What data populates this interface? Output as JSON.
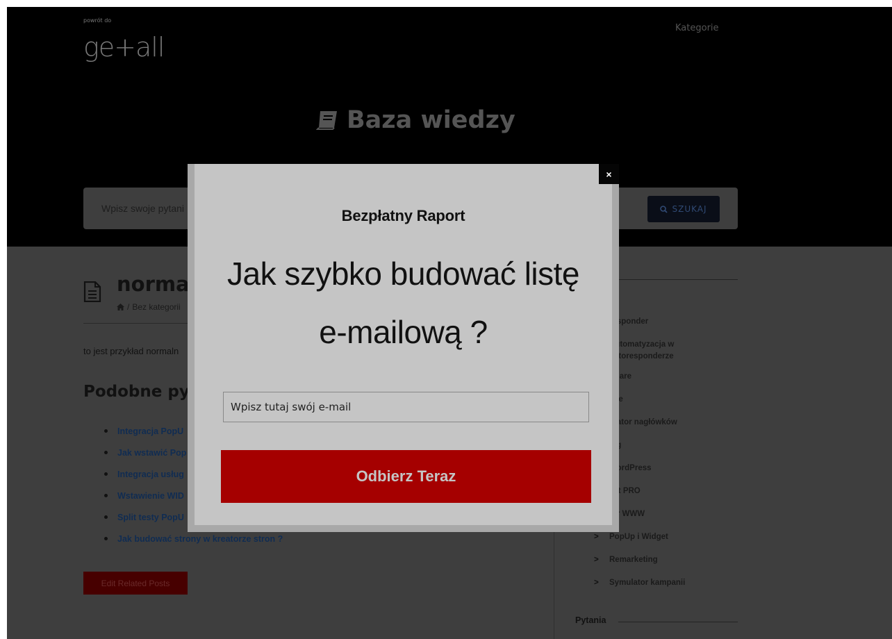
{
  "header": {
    "back_link": "powrót do",
    "logo": "ge+all",
    "nav_categories": "Kategorie",
    "hero_title": "Baza wiedzy",
    "search_placeholder": "Wpisz swoje pytani",
    "search_button": "SZUKAJ"
  },
  "post": {
    "title": "normaln",
    "breadcrumb_sep": "/",
    "breadcrumb_category": "Bez kategorii",
    "body": "to jest przykład normaln",
    "related_title": "Podobne pytan",
    "related_items": [
      "Integracja PopU",
      "Jak wstawić Pop",
      "Integracja usług",
      "Wstawienie WID",
      "Split testy PopU",
      "Jak budować strony w kreatorze stron ?"
    ],
    "edit_button": "Edit Related Posts"
  },
  "sidebar": {
    "items": [
      "responder",
      "Automatyzacja w autoresponderze",
      "Share",
      "nse",
      "erator nagłówków",
      "ing",
      "WordPress",
      "est PRO",
      "tor WWW",
      "PopUp i Widget",
      "Remarketing",
      "Symulator kampanii"
    ],
    "pytania": "Pytania"
  },
  "modal": {
    "close": "×",
    "subtitle": "Bezpłatny Raport",
    "headline_line1": "Jak szybko budować listę",
    "headline_line2": "e-mailową ?",
    "email_placeholder": "Wpisz tutaj swój e-mail",
    "cta": "Odbierz Teraz"
  },
  "colors": {
    "header_bg": "#000000",
    "overlay_bg": "#3e3e3e",
    "modal_bg": "#c5c5c5",
    "cta_bg": "#a50000",
    "edit_btn_bg": "#470000",
    "link_color": "#102c52"
  }
}
